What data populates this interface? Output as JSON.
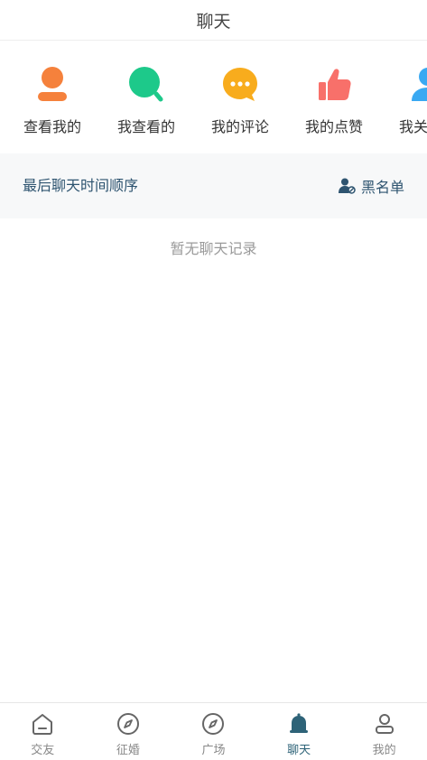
{
  "header": {
    "title": "聊天"
  },
  "shortcuts": [
    {
      "label": "查看我的",
      "icon": "person-icon",
      "color": "#f5813c"
    },
    {
      "label": "我查看的",
      "icon": "magnifier-icon",
      "color": "#1dc98a"
    },
    {
      "label": "我的评论",
      "icon": "comment-bubble-icon",
      "color": "#f8ac1d"
    },
    {
      "label": "我的点赞",
      "icon": "thumbs-up-icon",
      "color": "#f8706a"
    },
    {
      "label": "我关注的",
      "icon": "person-follow-icon",
      "color": "#3aa9f2"
    }
  ],
  "sort_bar": {
    "label": "最后聊天时间顺序",
    "blacklist_label": "黑名单"
  },
  "empty_state": {
    "text": "暂无聊天记录"
  },
  "tabbar": {
    "active_color": "#2e6378",
    "items": [
      {
        "label": "交友",
        "icon": "home-icon",
        "active": false
      },
      {
        "label": "征婚",
        "icon": "compass-icon",
        "active": false
      },
      {
        "label": "广场",
        "icon": "compass-icon",
        "active": false
      },
      {
        "label": "聊天",
        "icon": "bell-icon",
        "active": true
      },
      {
        "label": "我的",
        "icon": "user-icon",
        "active": false
      }
    ]
  }
}
